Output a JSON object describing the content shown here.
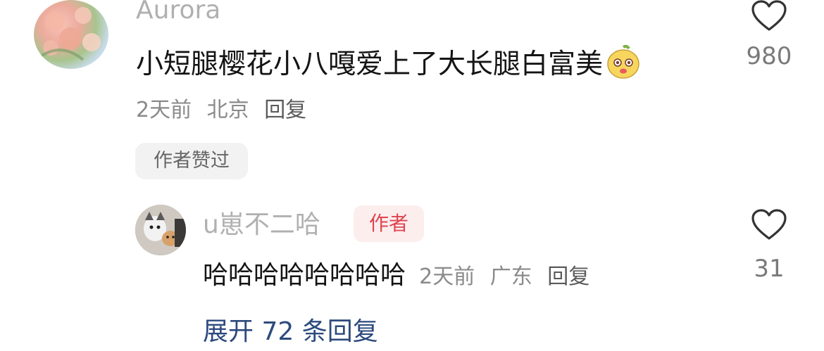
{
  "comment": {
    "username": "Aurora",
    "text": "小短腿樱花小八嘎爱上了大长腿白富美",
    "emoji_icon": "cute-face-emoji-icon",
    "time": "2天前",
    "location": "北京",
    "reply_label": "回复",
    "author_liked_badge": "作者赞过",
    "like_count": "980"
  },
  "reply": {
    "username": "u崽不二哈",
    "author_tag": "作者",
    "text": "哈哈哈哈哈哈哈哈",
    "time": "2天前",
    "location": "广东",
    "reply_label": "回复",
    "like_count": "31"
  },
  "expand_replies": "展开 72 条回复",
  "colors": {
    "author_tag_bg": "#fdeeee",
    "author_tag_text": "#e0444f",
    "expand_link": "#2c4a7d",
    "username": "#b0b0b0"
  }
}
